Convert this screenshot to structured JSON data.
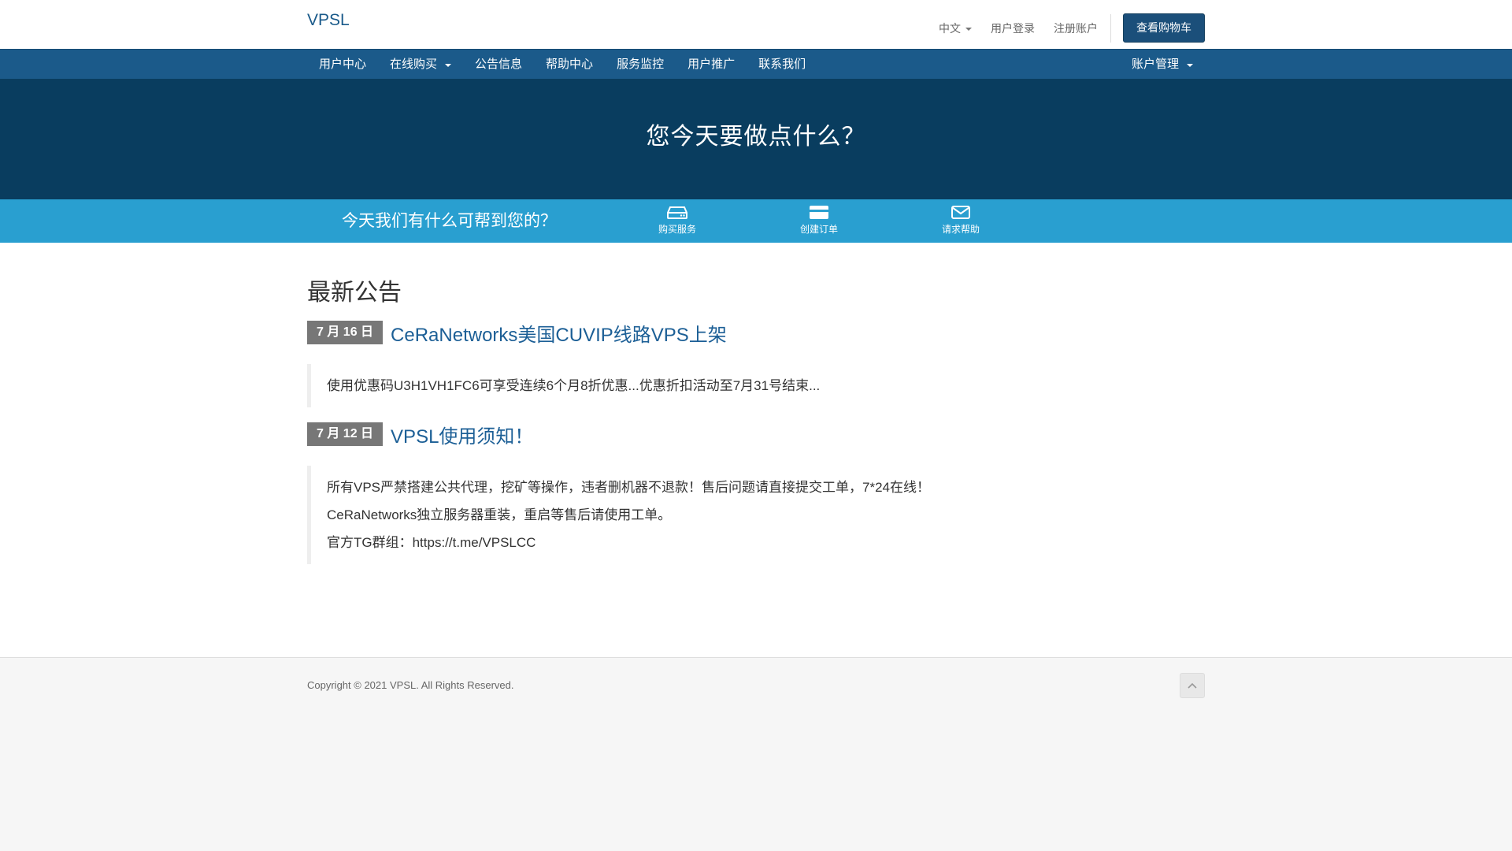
{
  "header": {
    "brand": "VPSL",
    "language": "中文",
    "login": "用户登录",
    "register": "注册账户",
    "cart_button": "查看购物车"
  },
  "nav": {
    "items": [
      {
        "label": "用户中心"
      },
      {
        "label": "在线购买"
      },
      {
        "label": "公告信息"
      },
      {
        "label": "帮助中心"
      },
      {
        "label": "服务监控"
      },
      {
        "label": "用户推广"
      },
      {
        "label": "联系我们"
      }
    ],
    "account": "账户管理"
  },
  "hero": {
    "title": "您今天要做点什么？"
  },
  "helpbar": {
    "text": "今天我们有什么可帮到您的？",
    "actions": [
      {
        "label": "购买服务",
        "icon": "server-icon"
      },
      {
        "label": "创建订单",
        "icon": "credit-card-icon"
      },
      {
        "label": "请求帮助",
        "icon": "envelope-icon"
      }
    ]
  },
  "announcements": {
    "title": "最新公告",
    "items": [
      {
        "date": "7 月 16 日",
        "title": "CeRaNetworks美国CUVIP线路VPS上架",
        "lines": [
          "使用优惠码U3H1VH1FC6可享受连续6个月8折优惠...优惠折扣活动至7月31号结束..."
        ]
      },
      {
        "date": "7 月 12 日",
        "title": "VPSL使用须知！",
        "lines": [
          "所有VPS严禁搭建公共代理，挖矿等操作，违者删机器不退款！售后问题请直接提交工单，7*24在线！",
          "CeRaNetworks独立服务器重装，重启等售后请使用工单。",
          "官方TG群组：https://t.me/VPSLCC"
        ]
      }
    ]
  },
  "footer": {
    "copyright": "Copyright © 2021 VPSL. All Rights Reserved."
  },
  "colors": {
    "nav_bg": "#1b5a8a",
    "hero_bg": "#093d5f",
    "helpbar_bg": "#299fd0",
    "link": "#1c5f96",
    "badge_bg": "#777777"
  }
}
